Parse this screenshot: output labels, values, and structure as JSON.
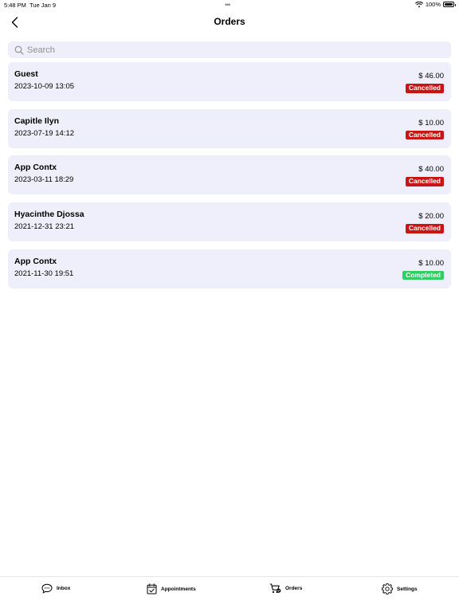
{
  "status_bar": {
    "time": "5:48 PM",
    "date": "Tue Jan 9",
    "dots": "•••",
    "battery": "100%"
  },
  "nav": {
    "title": "Orders"
  },
  "search": {
    "placeholder": "Search",
    "value": ""
  },
  "orders": [
    {
      "name": "Guest",
      "date": "2023-10-09 13:05",
      "amount": "$ 46.00",
      "status": "Cancelled"
    },
    {
      "name": "Capitle Ilyn",
      "date": "2023-07-19 14:12",
      "amount": "$ 10.00",
      "status": "Cancelled"
    },
    {
      "name": "App Contx",
      "date": "2023-03-11 18:29",
      "amount": "$ 40.00",
      "status": "Cancelled"
    },
    {
      "name": "Hyacinthe Djossa",
      "date": "2021-12-31 23:21",
      "amount": "$ 20.00",
      "status": "Cancelled"
    },
    {
      "name": "App Contx",
      "date": "2021-11-30 19:51",
      "amount": "$ 10.00",
      "status": "Completed"
    }
  ],
  "colors": {
    "card_bg": "#efeffb",
    "cancelled": "#c81515",
    "completed": "#2fcf63"
  },
  "tabs": [
    {
      "label": "Inbox",
      "icon": "chat-bubble-icon"
    },
    {
      "label": "Appointments",
      "icon": "calendar-check-icon"
    },
    {
      "label": "Orders",
      "icon": "cart-check-icon"
    },
    {
      "label": "Settings",
      "icon": "gear-icon"
    }
  ]
}
